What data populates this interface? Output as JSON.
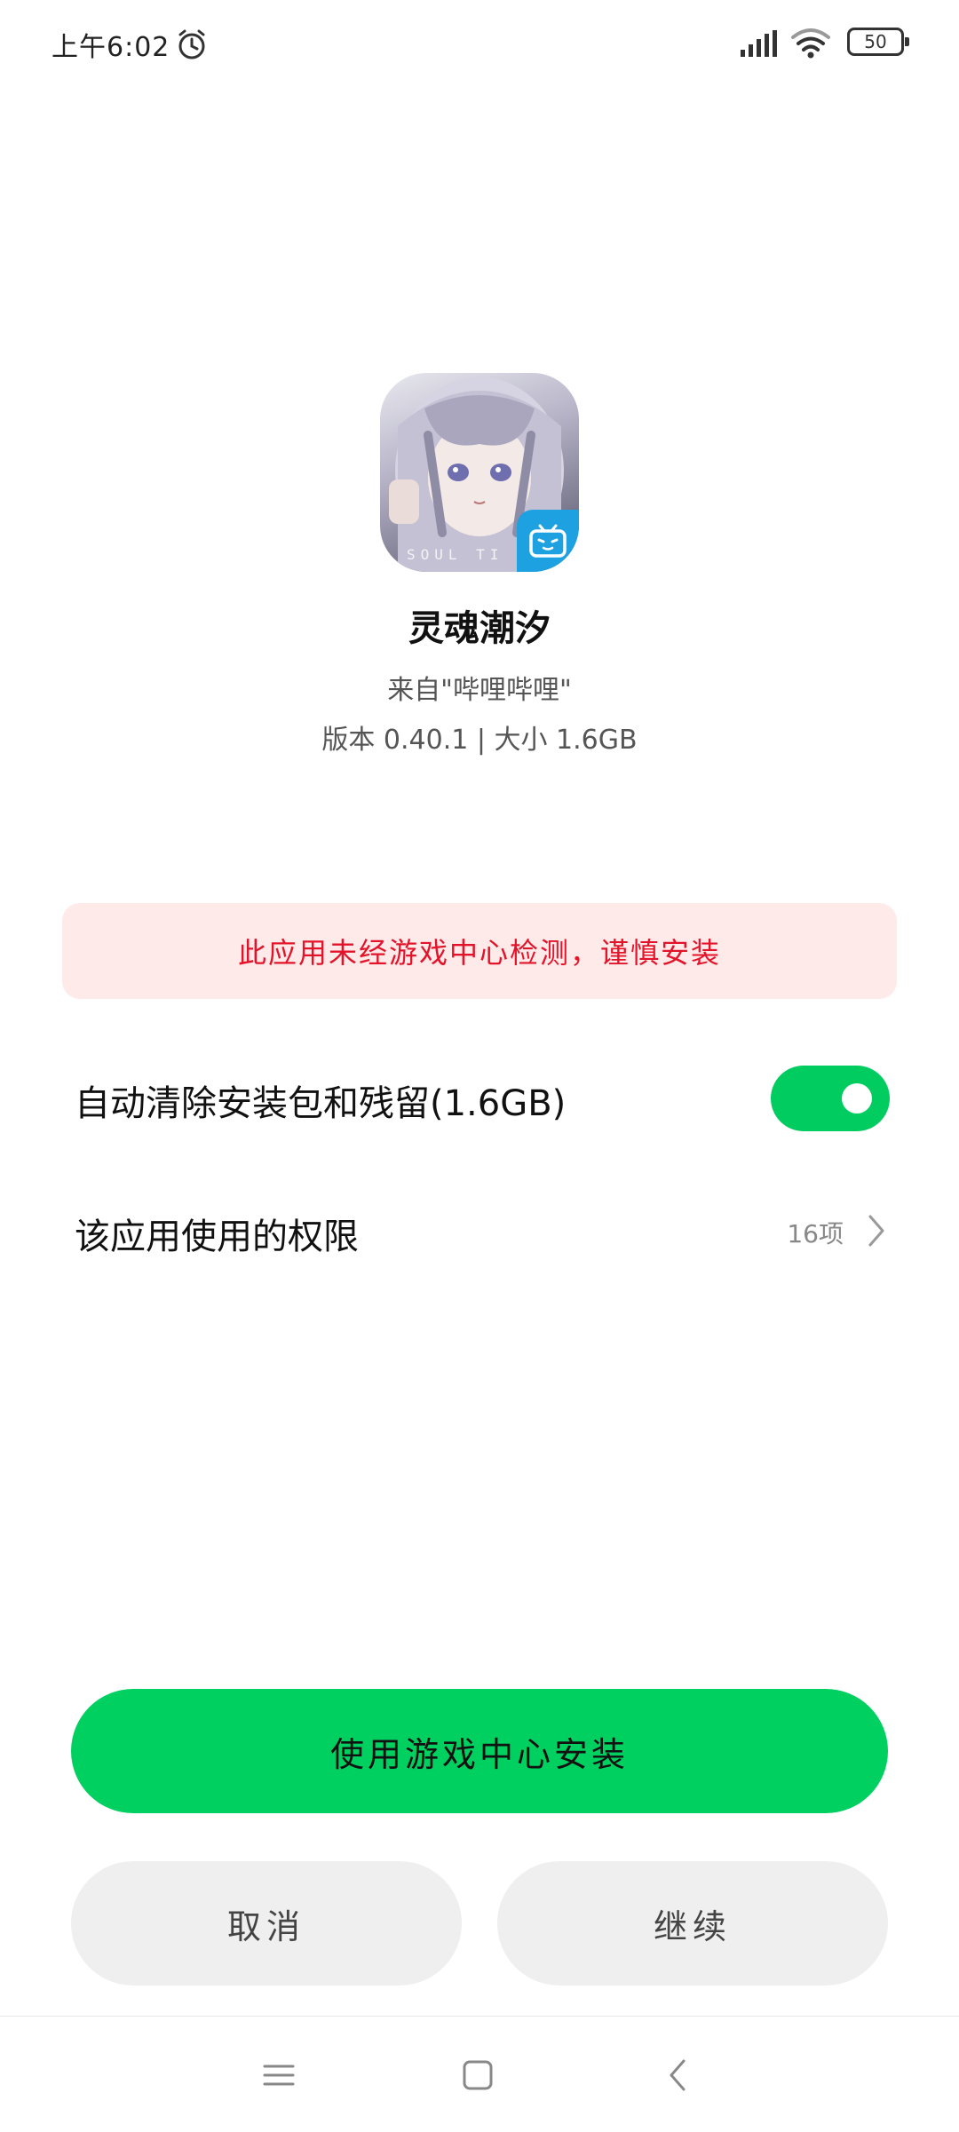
{
  "status_bar": {
    "time": "上午6:02",
    "battery": "50",
    "icons": [
      "alarm-icon",
      "signal-icon",
      "wifi-icon",
      "battery-icon"
    ]
  },
  "app": {
    "name": "灵魂潮汐",
    "source": "来自\"哔哩哔哩\"",
    "version_line": "版本 0.40.1 | 大小 1.6GB",
    "icon_brand_text": "SOUL TI",
    "icon_badge": "bilibili-icon"
  },
  "warning": {
    "text": "此应用未经游戏中心检测，谨慎安装",
    "color": "#e3142a",
    "background": "#ffeaea"
  },
  "settings": {
    "auto_clean": {
      "label": "自动清除安装包和残留(1.6GB)",
      "enabled": true
    },
    "permissions": {
      "label": "该应用使用的权限",
      "count": "16项"
    }
  },
  "buttons": {
    "primary": "使用游戏中心安装",
    "cancel": "取消",
    "continue": "继续"
  },
  "colors": {
    "accent": "#00d060",
    "toggle_on": "#00cc60",
    "secondary_button": "#efefef"
  },
  "nav_bar": {
    "icons": [
      "menu-icon",
      "home-icon",
      "back-icon"
    ]
  }
}
